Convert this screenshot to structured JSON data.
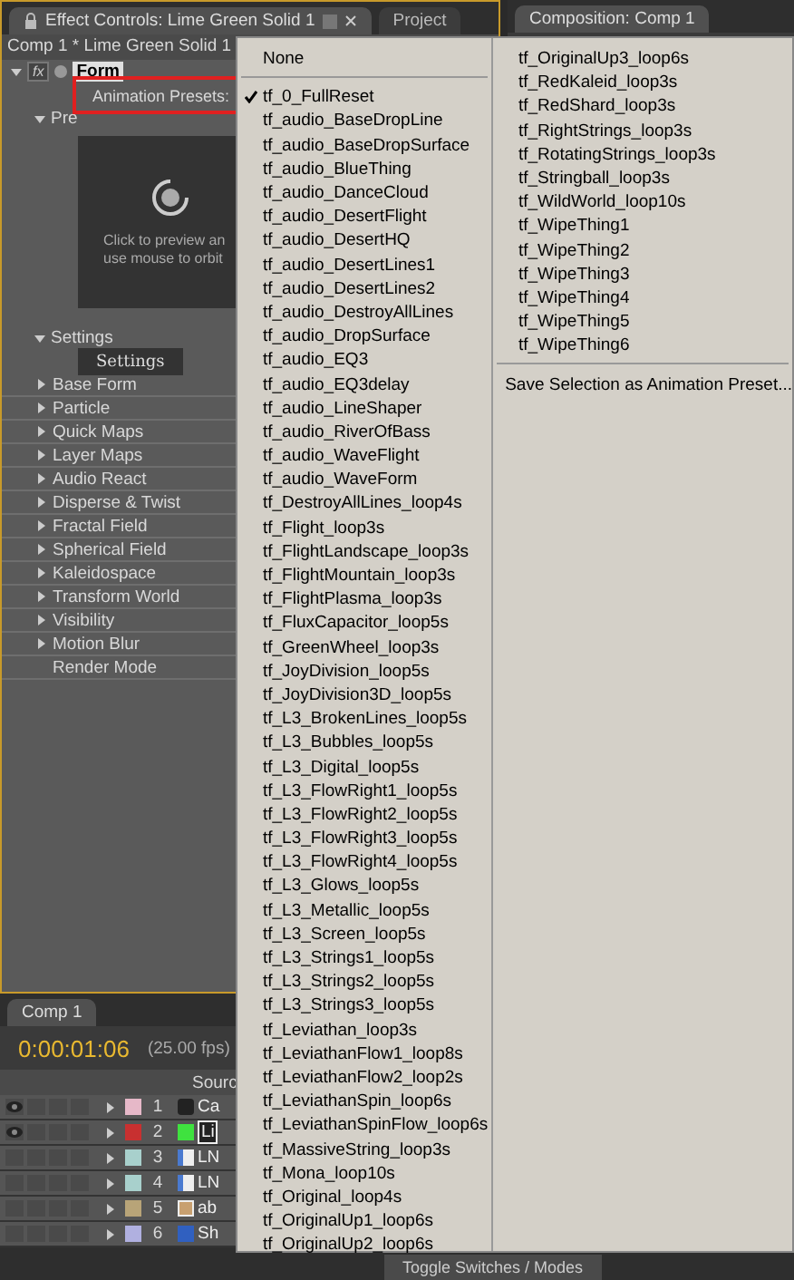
{
  "effect_panel": {
    "tabs": [
      {
        "label": "Effect Controls: Lime Green Solid 1",
        "selected": true
      },
      {
        "label": "Project",
        "selected": false
      }
    ],
    "breadcrumb": "Comp 1 * Lime Green Solid 1",
    "fx_badge": "fx",
    "effect_name": "Form",
    "preset_label": "Animation Presets:",
    "preview_heading": "Pre",
    "preview_hint": [
      "Click to preview an",
      "use mouse to orbit"
    ],
    "settings_heading": "Settings",
    "settings_button": "Settings",
    "groups": [
      {
        "label": "Base Form",
        "kind": "group"
      },
      {
        "label": "Particle",
        "kind": "group"
      },
      {
        "label": "Quick Maps",
        "kind": "group"
      },
      {
        "label": "Layer Maps",
        "kind": "group"
      },
      {
        "label": "Audio React",
        "kind": "group"
      },
      {
        "label": "Disperse & Twist",
        "kind": "group"
      },
      {
        "label": "Fractal Field",
        "kind": "group"
      },
      {
        "label": "Spherical Field",
        "kind": "group"
      },
      {
        "label": "Kaleidospace",
        "kind": "group"
      },
      {
        "label": "Transform World",
        "kind": "group"
      },
      {
        "label": "Visibility",
        "kind": "group"
      },
      {
        "label": "Motion Blur",
        "kind": "group"
      },
      {
        "label": "Render Mode",
        "kind": "item"
      }
    ]
  },
  "composition_panel": {
    "tab": "Composition: Comp 1"
  },
  "timeline": {
    "tab": "Comp 1",
    "timecode": "0:00:01:06",
    "fps": "(25.00 fps)",
    "column_source": "Sourc",
    "layers": [
      {
        "number": "1",
        "color": "#e6b8c8",
        "visible": true,
        "audio": false,
        "solo": false,
        "locked": false,
        "selected": false,
        "kind": "camera",
        "name": "Ca"
      },
      {
        "number": "2",
        "color": "#c83030",
        "visible": true,
        "audio": false,
        "solo": false,
        "locked": false,
        "selected": true,
        "kind": "solid",
        "name": "Li"
      },
      {
        "number": "3",
        "color": "#a8d0cc",
        "visible": false,
        "audio": false,
        "solo": false,
        "locked": false,
        "selected": false,
        "kind": "file",
        "name": "LN"
      },
      {
        "number": "4",
        "color": "#a8d0cc",
        "visible": false,
        "audio": false,
        "solo": false,
        "locked": false,
        "selected": false,
        "kind": "file",
        "name": "LN"
      },
      {
        "number": "5",
        "color": "#b8a478",
        "visible": false,
        "audio": false,
        "solo": false,
        "locked": false,
        "selected": false,
        "kind": "image",
        "name": "ab"
      },
      {
        "number": "6",
        "color": "#b0b0e0",
        "visible": false,
        "audio": false,
        "solo": false,
        "locked": false,
        "selected": false,
        "kind": "shape",
        "name": "Sh"
      }
    ],
    "toggle_button": "Toggle Switches / Modes"
  },
  "preset_menu": {
    "none_item": "None",
    "columns": [
      [
        {
          "label": "tf_0_FullReset",
          "checked": true
        },
        {
          "label": "tf_audio_BaseDropLine",
          "checked": false
        },
        {
          "label": "tf_audio_BaseDropSurface",
          "checked": false
        },
        {
          "label": "tf_audio_BlueThing",
          "checked": false
        },
        {
          "label": "tf_audio_DanceCloud",
          "checked": false
        },
        {
          "label": "tf_audio_DesertFlight",
          "checked": false
        },
        {
          "label": "tf_audio_DesertHQ",
          "checked": false
        },
        {
          "label": "tf_audio_DesertLines1",
          "checked": false
        },
        {
          "label": "tf_audio_DesertLines2",
          "checked": false
        },
        {
          "label": "tf_audio_DestroyAllLines",
          "checked": false
        },
        {
          "label": "tf_audio_DropSurface",
          "checked": false
        },
        {
          "label": "tf_audio_EQ3",
          "checked": false
        },
        {
          "label": "tf_audio_EQ3delay",
          "checked": false
        },
        {
          "label": "tf_audio_LineShaper",
          "checked": false
        },
        {
          "label": "tf_audio_RiverOfBass",
          "checked": false
        },
        {
          "label": "tf_audio_WaveFlight",
          "checked": false
        },
        {
          "label": "tf_audio_WaveForm",
          "checked": false
        },
        {
          "label": "tf_DestroyAllLines_loop4s",
          "checked": false
        },
        {
          "label": "tf_Flight_loop3s",
          "checked": false
        },
        {
          "label": "tf_FlightLandscape_loop3s",
          "checked": false
        },
        {
          "label": "tf_FlightMountain_loop3s",
          "checked": false
        },
        {
          "label": "tf_FlightPlasma_loop3s",
          "checked": false
        },
        {
          "label": "tf_FluxCapacitor_loop5s",
          "checked": false
        },
        {
          "label": "tf_GreenWheel_loop3s",
          "checked": false
        },
        {
          "label": "tf_JoyDivision_loop5s",
          "checked": false
        },
        {
          "label": "tf_JoyDivision3D_loop5s",
          "checked": false
        },
        {
          "label": "tf_L3_BrokenLines_loop5s",
          "checked": false
        },
        {
          "label": "tf_L3_Bubbles_loop5s",
          "checked": false
        },
        {
          "label": "tf_L3_Digital_loop5s",
          "checked": false
        },
        {
          "label": "tf_L3_FlowRight1_loop5s",
          "checked": false
        },
        {
          "label": "tf_L3_FlowRight2_loop5s",
          "checked": false
        },
        {
          "label": "tf_L3_FlowRight3_loop5s",
          "checked": false
        },
        {
          "label": "tf_L3_FlowRight4_loop5s",
          "checked": false
        },
        {
          "label": "tf_L3_Glows_loop5s",
          "checked": false
        },
        {
          "label": "tf_L3_Metallic_loop5s",
          "checked": false
        },
        {
          "label": "tf_L3_Screen_loop5s",
          "checked": false
        },
        {
          "label": "tf_L3_Strings1_loop5s",
          "checked": false
        },
        {
          "label": "tf_L3_Strings2_loop5s",
          "checked": false
        },
        {
          "label": "tf_L3_Strings3_loop5s",
          "checked": false
        },
        {
          "label": "tf_Leviathan_loop3s",
          "checked": false
        },
        {
          "label": "tf_LeviathanFlow1_loop8s",
          "checked": false
        },
        {
          "label": "tf_LeviathanFlow2_loop2s",
          "checked": false
        },
        {
          "label": "tf_LeviathanSpin_loop6s",
          "checked": false
        },
        {
          "label": "tf_LeviathanSpinFlow_loop6s",
          "checked": false
        },
        {
          "label": "tf_MassiveString_loop3s",
          "checked": false
        },
        {
          "label": "tf_Mona_loop10s",
          "checked": false
        },
        {
          "label": "tf_Original_loop4s",
          "checked": false
        },
        {
          "label": "tf_OriginalUp1_loop6s",
          "checked": false
        },
        {
          "label": "tf_OriginalUp2_loop6s",
          "checked": false
        }
      ],
      [
        {
          "label": "tf_OriginalUp3_loop6s",
          "checked": false
        },
        {
          "label": "tf_RedKaleid_loop3s",
          "checked": false
        },
        {
          "label": "tf_RedShard_loop3s",
          "checked": false
        },
        {
          "label": "tf_RightStrings_loop3s",
          "checked": false
        },
        {
          "label": "tf_RotatingStrings_loop3s",
          "checked": false
        },
        {
          "label": "tf_Stringball_loop3s",
          "checked": false
        },
        {
          "label": "tf_WildWorld_loop10s",
          "checked": false
        },
        {
          "label": "tf_WipeThing1",
          "checked": false
        },
        {
          "label": "tf_WipeThing2",
          "checked": false
        },
        {
          "label": "tf_WipeThing3",
          "checked": false
        },
        {
          "label": "tf_WipeThing4",
          "checked": false
        },
        {
          "label": "tf_WipeThing5",
          "checked": false
        },
        {
          "label": "tf_WipeThing6",
          "checked": false
        }
      ]
    ],
    "save_item": "Save Selection as Animation Preset..."
  }
}
